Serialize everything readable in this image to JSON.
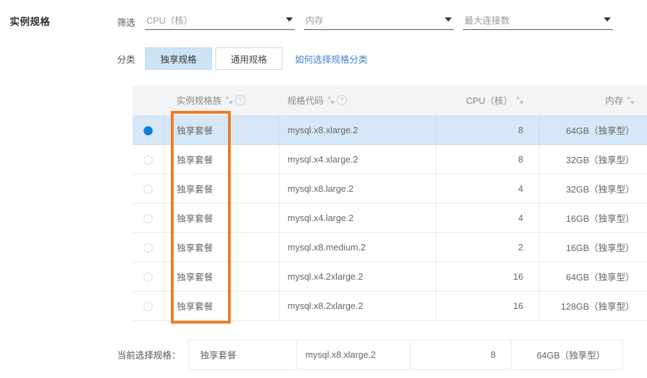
{
  "page_title": "实例规格",
  "filter": {
    "label": "筛选",
    "selects": [
      {
        "name": "cpu",
        "value": "CPU（核）"
      },
      {
        "name": "memory",
        "value": "内存"
      },
      {
        "name": "max_connections",
        "value": "最大连接数"
      }
    ]
  },
  "category": {
    "label": "分类",
    "buttons": [
      {
        "label": "独享规格",
        "active": true
      },
      {
        "label": "通用规格",
        "active": false
      }
    ],
    "help_link": "如何选择规格分类"
  },
  "table": {
    "headers": {
      "family": "实例规格族",
      "code": "规格代码",
      "cpu": "CPU（核）",
      "memory": "内存",
      "help_glyph": "?"
    },
    "rows": [
      {
        "selected": true,
        "family": "独享套餐",
        "code": "mysql.x8.xlarge.2",
        "cpu": "8",
        "memory": "64GB（独享型）"
      },
      {
        "selected": false,
        "family": "独享套餐",
        "code": "mysql.x4.xlarge.2",
        "cpu": "8",
        "memory": "32GB（独享型）"
      },
      {
        "selected": false,
        "family": "独享套餐",
        "code": "mysql.x8.large.2",
        "cpu": "4",
        "memory": "32GB（独享型）"
      },
      {
        "selected": false,
        "family": "独享套餐",
        "code": "mysql.x4.large.2",
        "cpu": "4",
        "memory": "16GB（独享型）"
      },
      {
        "selected": false,
        "family": "独享套餐",
        "code": "mysql.x8.medium.2",
        "cpu": "2",
        "memory": "16GB（独享型）"
      },
      {
        "selected": false,
        "family": "独享套餐",
        "code": "mysql.x4.2xlarge.2",
        "cpu": "16",
        "memory": "64GB（独享型）"
      },
      {
        "selected": false,
        "family": "独享套餐",
        "code": "mysql.x8.2xlarge.2",
        "cpu": "16",
        "memory": "128GB（独享型）"
      }
    ]
  },
  "summary": {
    "label": "当前选择规格：",
    "family": "独享套餐",
    "code": "mysql.x8.xlarge.2",
    "cpu": "8",
    "memory": "64GB（独享型）"
  },
  "colors": {
    "accent_blue": "#1080d8",
    "selected_row": "#d6e8f7",
    "annotation_orange": "#f07b21",
    "link_blue": "#3c82c8"
  }
}
